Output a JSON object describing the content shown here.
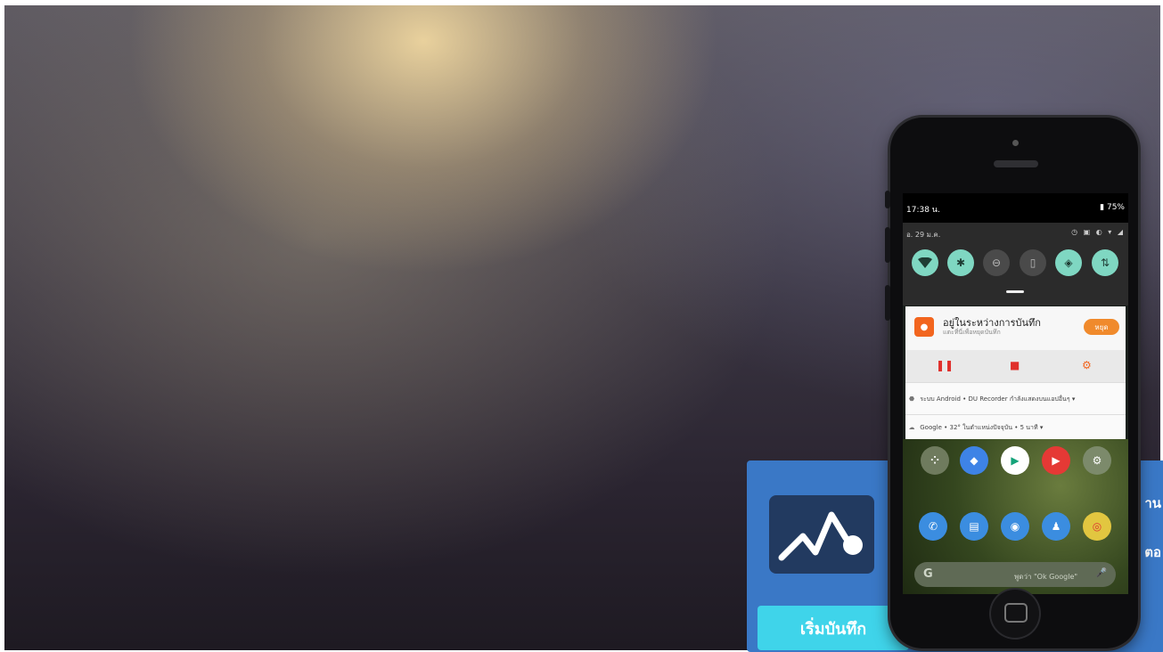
{
  "background_card": {
    "button_label": "เริ่มบันทึก",
    "edge_labels": [
      "าน",
      "ตอ"
    ]
  },
  "phone": {
    "status_bar": {
      "time": "17:38 น.",
      "battery": "75%"
    },
    "quick_settings": {
      "date": "อ. 29 ม.ค.",
      "tiles": [
        "wifi",
        "bluetooth",
        "dnd",
        "flashlight",
        "auto-rotate",
        "data"
      ]
    },
    "notification": {
      "title": "อยู่ในระหว่างการบันทึก",
      "subtitle": "แตะที่นี่เพื่อหยุดบันทึก",
      "button": "หยุด",
      "actions": [
        "pause",
        "stop",
        "tools"
      ]
    },
    "system_row": "ระบบ Android • DU Recorder กำลังแสดงบนแอปอื่นๆ",
    "weather_row": "Google • 32° ในตำแหน่งปัจจุบัน • 5 นาที",
    "home_labels": [
      "Play Store",
      "YouTube",
      "ตั้งค่า"
    ],
    "search_placeholder": "พูดว่า \"Ok Google\""
  },
  "colors": {
    "card": "#3a78c6",
    "card_button": "#3fd4ea",
    "tile_on": "#7fd7c2",
    "recorder_accent": "#f2651e"
  }
}
